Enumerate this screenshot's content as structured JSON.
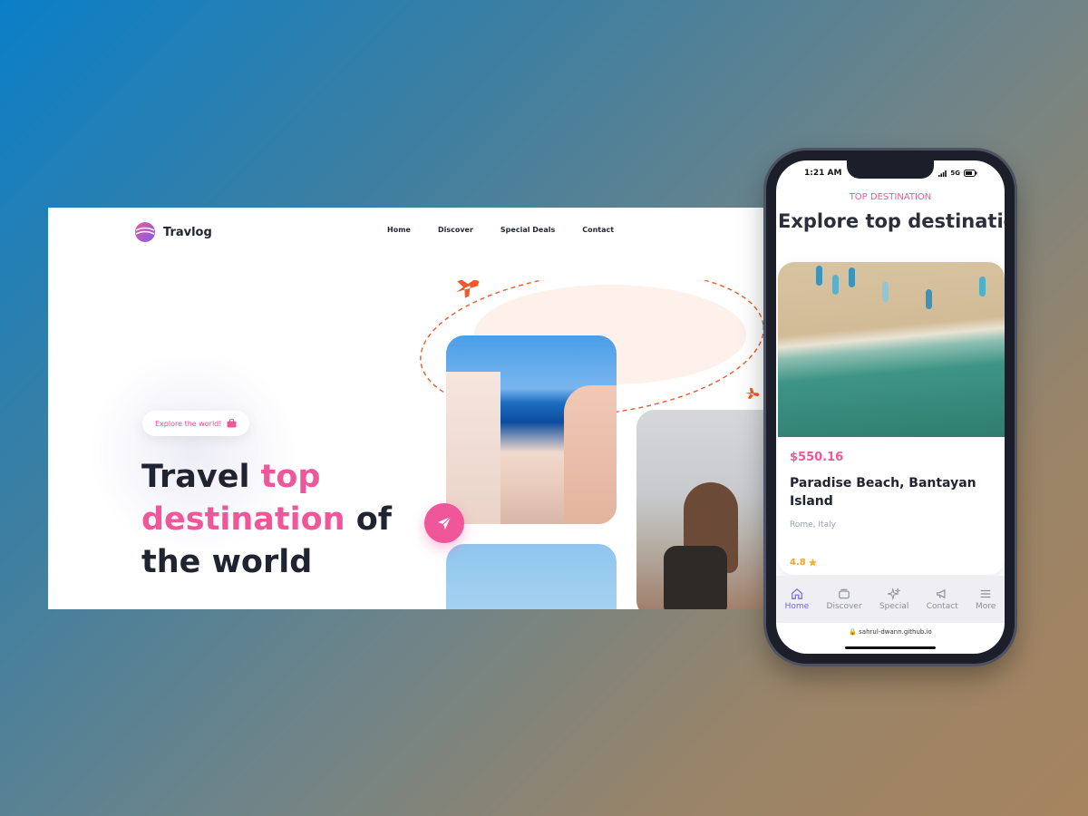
{
  "desktop": {
    "brand": "Travlog",
    "nav": [
      "Home",
      "Discover",
      "Special Deals",
      "Contact"
    ],
    "pill_label": "Explore the world!",
    "headline": {
      "part1": "Travel ",
      "pink1": "top",
      "pink2": "destination",
      "part2": " of",
      "part3": "the world"
    }
  },
  "phone": {
    "status_time": "1:21 AM",
    "status_network": "5G",
    "eyebrow": "TOP DESTINATION",
    "title": "Explore top destination",
    "card": {
      "price": "$550.16",
      "place": "Paradise Beach, Bantayan Island",
      "location": "Rome, Italy",
      "rating": "4.8"
    },
    "tabs": [
      {
        "label": "Home",
        "icon": "home-icon",
        "active": true
      },
      {
        "label": "Discover",
        "icon": "discover-icon",
        "active": false
      },
      {
        "label": "Special",
        "icon": "sparkle-icon",
        "active": false
      },
      {
        "label": "Contact",
        "icon": "megaphone-icon",
        "active": false
      },
      {
        "label": "More",
        "icon": "menu-icon",
        "active": false
      }
    ],
    "url": "sahrul-dwann.github.io"
  },
  "colors": {
    "accent_pink": "#f0579a",
    "text_dark": "#1f2430",
    "tab_active": "#6f63e8",
    "rating": "#f2a32b",
    "plane_orange": "#ef5a2a"
  }
}
